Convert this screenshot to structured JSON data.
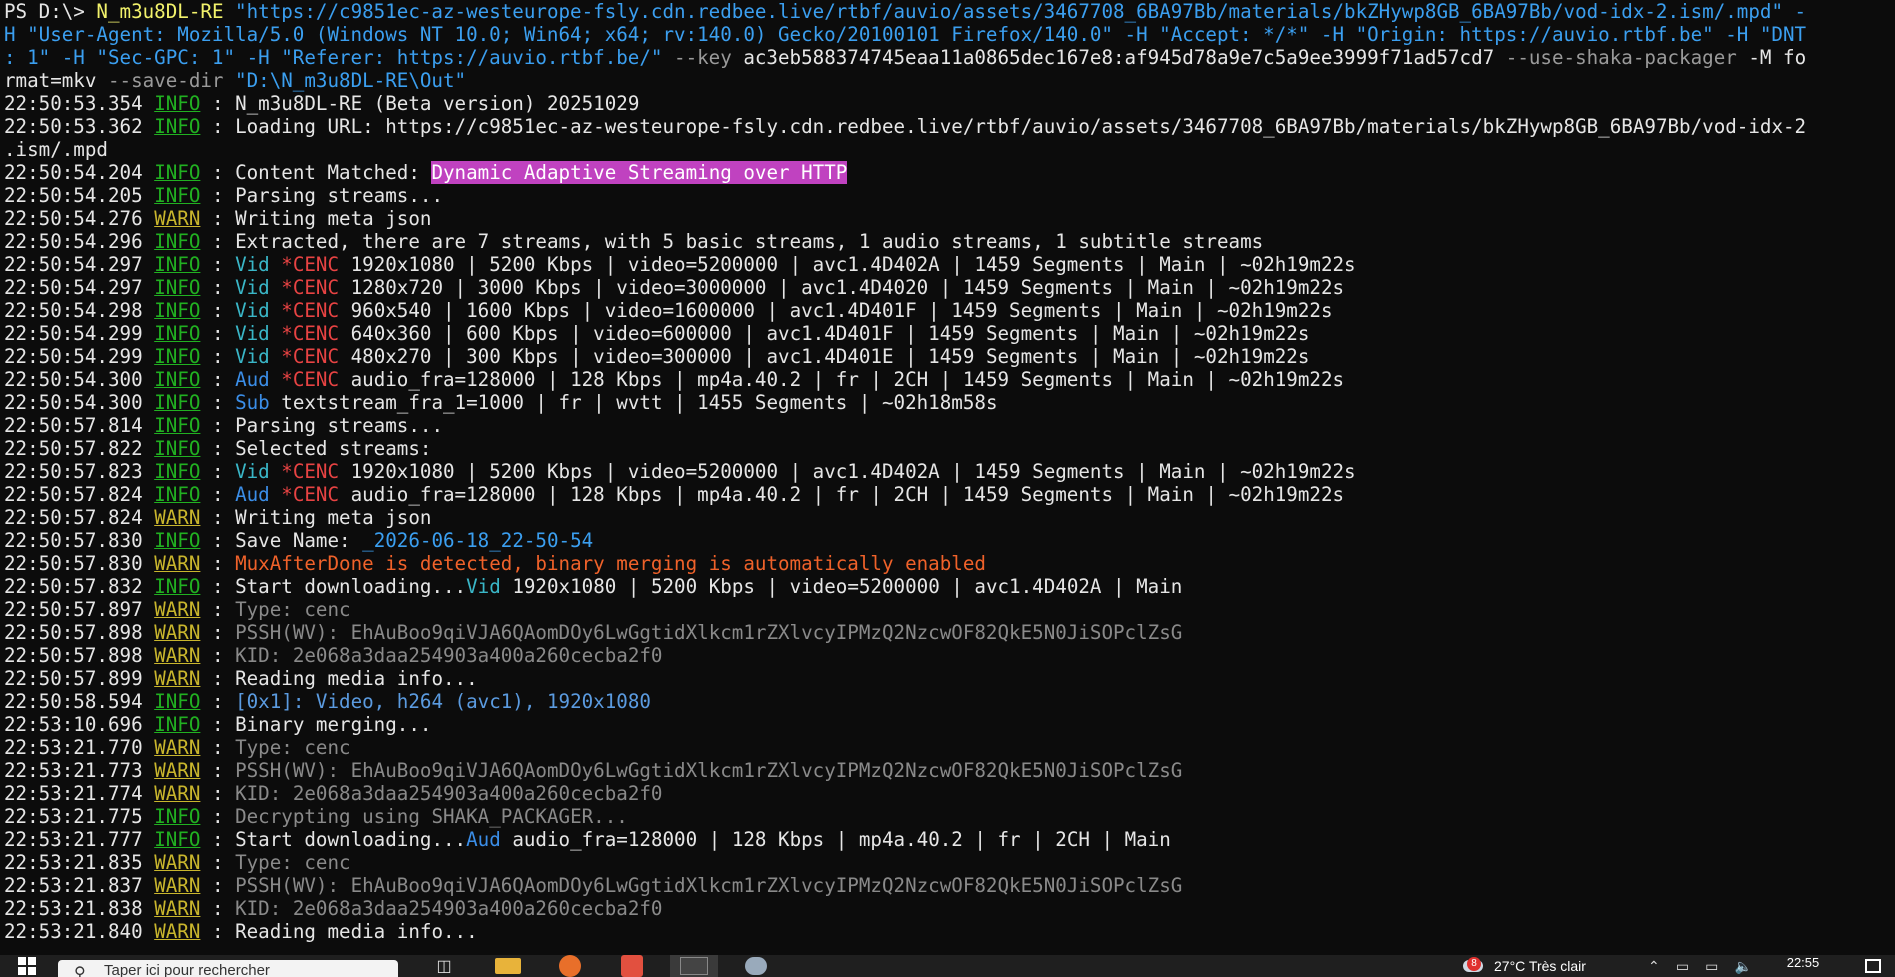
{
  "terminal": {
    "cmd_prompt": "PS D:\\> ",
    "cmd_exe": "N_m3u8DL-RE",
    "cmd_rest_1": " \"https://c9851ec-az-westeurope-fsly.cdn.redbee.live/rtbf/auvio/assets/3467708_6BA97Bb/materials/bkZHywp8GB_6BA97Bb/vod-idx-2.ism/.mpd\" -",
    "cmd_rest_2": "H \"User-Agent: Mozilla/5.0 (Windows NT 10.0; Win64; x64; rv:140.0) Gecko/20100101 Firefox/140.0\" -H \"Accept: */*\" -H \"Origin: https://auvio.rtbf.be\" -H \"DNT",
    "cmd_rest_3a": ": 1\" -H \"Sec-GPC: 1\" -H \"Referer: https://auvio.rtbf.be/\" ",
    "cmd_key_flag": "--key",
    "cmd_key_val": " ac3eb588374745eaa11a0865dec167e8:af945d78a9e7c5a9ee3999f71ad57cd7 ",
    "cmd_shaka": "--use-shaka-packager",
    "cmd_m": " -M fo",
    "cmd_rest_4a": "rmat=mkv ",
    "cmd_save_flag": "--save-dir",
    "cmd_save_val": " \"D:\\N_m3u8DL-RE\\Out\"",
    "lines": [
      {
        "ts": "22:50:53.354",
        "lvl": "INFO",
        "parts": [
          {
            "t": "N_m3u8DL-RE (Beta version) 20251029",
            "c": "msg"
          }
        ]
      },
      {
        "ts": "22:50:53.362",
        "lvl": "INFO",
        "parts": [
          {
            "t": "Loading URL: https://c9851ec-az-westeurope-fsly.cdn.redbee.live/rtbf/auvio/assets/3467708_6BA97Bb/materials/bkZHywp8GB_6BA97Bb/vod-idx-2",
            "c": "msg"
          }
        ]
      },
      {
        "ts": "",
        "lvl": "",
        "parts": [
          {
            "t": ".ism/.mpd",
            "c": "msg"
          }
        ]
      },
      {
        "ts": "22:50:54.204",
        "lvl": "INFO",
        "parts": [
          {
            "t": "Content Matched: ",
            "c": "msg"
          },
          {
            "t": "Dynamic Adaptive Streaming over HTTP",
            "c": "hl"
          }
        ]
      },
      {
        "ts": "22:50:54.205",
        "lvl": "INFO",
        "parts": [
          {
            "t": "Parsing streams...",
            "c": "msg"
          }
        ]
      },
      {
        "ts": "22:50:54.276",
        "lvl": "WARN",
        "parts": [
          {
            "t": "Writing meta json",
            "c": "msg"
          }
        ]
      },
      {
        "ts": "22:50:54.296",
        "lvl": "INFO",
        "parts": [
          {
            "t": "Extracted, there are 7 streams, with 5 basic streams, 1 audio streams, 1 subtitle streams",
            "c": "msg"
          }
        ]
      },
      {
        "ts": "22:50:54.297",
        "lvl": "INFO",
        "parts": [
          {
            "t": "Vid ",
            "c": "vid"
          },
          {
            "t": "*CENC ",
            "c": "cenc"
          },
          {
            "t": "1920x1080 | 5200 Kbps | video=5200000 | avc1.4D402A | 1459 Segments | Main | ~02h19m22s",
            "c": "msg"
          }
        ]
      },
      {
        "ts": "22:50:54.297",
        "lvl": "INFO",
        "parts": [
          {
            "t": "Vid ",
            "c": "vid"
          },
          {
            "t": "*CENC ",
            "c": "cenc"
          },
          {
            "t": "1280x720 | 3000 Kbps | video=3000000 | avc1.4D4020 | 1459 Segments | Main | ~02h19m22s",
            "c": "msg"
          }
        ]
      },
      {
        "ts": "22:50:54.298",
        "lvl": "INFO",
        "parts": [
          {
            "t": "Vid ",
            "c": "vid"
          },
          {
            "t": "*CENC ",
            "c": "cenc"
          },
          {
            "t": "960x540 | 1600 Kbps | video=1600000 | avc1.4D401F | 1459 Segments | Main | ~02h19m22s",
            "c": "msg"
          }
        ]
      },
      {
        "ts": "22:50:54.299",
        "lvl": "INFO",
        "parts": [
          {
            "t": "Vid ",
            "c": "vid"
          },
          {
            "t": "*CENC ",
            "c": "cenc"
          },
          {
            "t": "640x360 | 600 Kbps | video=600000 | avc1.4D401F | 1459 Segments | Main | ~02h19m22s",
            "c": "msg"
          }
        ]
      },
      {
        "ts": "22:50:54.299",
        "lvl": "INFO",
        "parts": [
          {
            "t": "Vid ",
            "c": "vid"
          },
          {
            "t": "*CENC ",
            "c": "cenc"
          },
          {
            "t": "480x270 | 300 Kbps | video=300000 | avc1.4D401E | 1459 Segments | Main | ~02h19m22s",
            "c": "msg"
          }
        ]
      },
      {
        "ts": "22:50:54.300",
        "lvl": "INFO",
        "parts": [
          {
            "t": "Aud ",
            "c": "aud"
          },
          {
            "t": "*CENC ",
            "c": "cenc"
          },
          {
            "t": "audio_fra=128000 | 128 Kbps | mp4a.40.2 | fr | 2CH | 1459 Segments | Main | ~02h19m22s",
            "c": "msg"
          }
        ]
      },
      {
        "ts": "22:50:54.300",
        "lvl": "INFO",
        "parts": [
          {
            "t": "Sub ",
            "c": "sub"
          },
          {
            "t": "textstream_fra_1=1000 | fr | wvtt | 1455 Segments | ~02h18m58s",
            "c": "msg"
          }
        ]
      },
      {
        "ts": "22:50:57.814",
        "lvl": "INFO",
        "parts": [
          {
            "t": "Parsing streams...",
            "c": "msg"
          }
        ]
      },
      {
        "ts": "22:50:57.822",
        "lvl": "INFO",
        "parts": [
          {
            "t": "Selected streams:",
            "c": "msg"
          }
        ]
      },
      {
        "ts": "22:50:57.823",
        "lvl": "INFO",
        "parts": [
          {
            "t": "Vid ",
            "c": "vid"
          },
          {
            "t": "*CENC ",
            "c": "cenc"
          },
          {
            "t": "1920x1080 | 5200 Kbps | video=5200000 | avc1.4D402A | 1459 Segments | Main | ~02h19m22s",
            "c": "msg"
          }
        ]
      },
      {
        "ts": "22:50:57.824",
        "lvl": "INFO",
        "parts": [
          {
            "t": "Aud ",
            "c": "aud"
          },
          {
            "t": "*CENC ",
            "c": "cenc"
          },
          {
            "t": "audio_fra=128000 | 128 Kbps | mp4a.40.2 | fr | 2CH | 1459 Segments | Main | ~02h19m22s",
            "c": "msg"
          }
        ]
      },
      {
        "ts": "22:50:57.824",
        "lvl": "WARN",
        "parts": [
          {
            "t": "Writing meta json",
            "c": "msg"
          }
        ]
      },
      {
        "ts": "22:50:57.830",
        "lvl": "INFO",
        "parts": [
          {
            "t": "Save Name: ",
            "c": "msg"
          },
          {
            "t": "_2026-06-18_22-50-54",
            "c": "cyan"
          }
        ]
      },
      {
        "ts": "22:50:57.830",
        "lvl": "WARN",
        "parts": [
          {
            "t": "MuxAfterDone is detected, binary merging is automatically enabled",
            "c": "orange"
          }
        ]
      },
      {
        "ts": "22:50:57.832",
        "lvl": "INFO",
        "parts": [
          {
            "t": "Start downloading...",
            "c": "msg"
          },
          {
            "t": "Vid ",
            "c": "vid"
          },
          {
            "t": "1920x1080 | 5200 Kbps | video=5200000 | avc1.4D402A | Main",
            "c": "msg"
          }
        ]
      },
      {
        "ts": "22:50:57.897",
        "lvl": "WARN",
        "parts": [
          {
            "t": "Type: cenc",
            "c": "dim"
          }
        ]
      },
      {
        "ts": "22:50:57.898",
        "lvl": "WARN",
        "parts": [
          {
            "t": "PSSH(WV): EhAuBoo9qiVJA6QAomDOy6LwGgtidXlkcm1rZXlvcyIPMzQ2NzcwOF82QkE5N0JiSOPclZsG",
            "c": "dim"
          }
        ]
      },
      {
        "ts": "22:50:57.898",
        "lvl": "WARN",
        "parts": [
          {
            "t": "KID: 2e068a3daa254903a400a260cecba2f0",
            "c": "dim"
          }
        ]
      },
      {
        "ts": "22:50:57.899",
        "lvl": "WARN",
        "parts": [
          {
            "t": "Reading media info...",
            "c": "msg"
          }
        ]
      },
      {
        "ts": "22:50:58.594",
        "lvl": "INFO",
        "parts": [
          {
            "t": "[0x1]: Video, h264 (avc1), 1920x1080",
            "c": "probe"
          }
        ]
      },
      {
        "ts": "22:53:10.696",
        "lvl": "INFO",
        "parts": [
          {
            "t": "Binary merging...",
            "c": "msg"
          }
        ]
      },
      {
        "ts": "22:53:21.770",
        "lvl": "WARN",
        "parts": [
          {
            "t": "Type: cenc",
            "c": "dim"
          }
        ]
      },
      {
        "ts": "22:53:21.773",
        "lvl": "WARN",
        "parts": [
          {
            "t": "PSSH(WV): EhAuBoo9qiVJA6QAomDOy6LwGgtidXlkcm1rZXlvcyIPMzQ2NzcwOF82QkE5N0JiSOPclZsG",
            "c": "dim"
          }
        ]
      },
      {
        "ts": "22:53:21.774",
        "lvl": "WARN",
        "parts": [
          {
            "t": "KID: 2e068a3daa254903a400a260cecba2f0",
            "c": "dim"
          }
        ]
      },
      {
        "ts": "22:53:21.775",
        "lvl": "INFO",
        "parts": [
          {
            "t": "Decrypting using SHAKA_PACKAGER...",
            "c": "dim"
          }
        ]
      },
      {
        "ts": "22:53:21.777",
        "lvl": "INFO",
        "parts": [
          {
            "t": "Start downloading...",
            "c": "msg"
          },
          {
            "t": "Aud ",
            "c": "aud"
          },
          {
            "t": "audio_fra=128000 | 128 Kbps | mp4a.40.2 | fr | 2CH | Main",
            "c": "msg"
          }
        ]
      },
      {
        "ts": "22:53:21.835",
        "lvl": "WARN",
        "parts": [
          {
            "t": "Type: cenc",
            "c": "dim"
          }
        ]
      },
      {
        "ts": "22:53:21.837",
        "lvl": "WARN",
        "parts": [
          {
            "t": "PSSH(WV): EhAuBoo9qiVJA6QAomDOy6LwGgtidXlkcm1rZXlvcyIPMzQ2NzcwOF82QkE5N0JiSOPclZsG",
            "c": "dim"
          }
        ]
      },
      {
        "ts": "22:53:21.838",
        "lvl": "WARN",
        "parts": [
          {
            "t": "KID: 2e068a3daa254903a400a260cecba2f0",
            "c": "dim"
          }
        ]
      },
      {
        "ts": "22:53:21.840",
        "lvl": "WARN",
        "parts": [
          {
            "t": "Reading media info...",
            "c": "msg"
          }
        ]
      }
    ]
  },
  "taskbar": {
    "search_placeholder": "Taper ici pour rechercher",
    "weather": "27°C  Très clair",
    "clock_time": "22:55",
    "notification_count": "8",
    "icons": [
      "windows-start-icon",
      "search-icon",
      "task-view-icon",
      "file-explorer-icon",
      "firefox-icon",
      "app-icon",
      "terminal-icon",
      "paint-icon"
    ]
  }
}
